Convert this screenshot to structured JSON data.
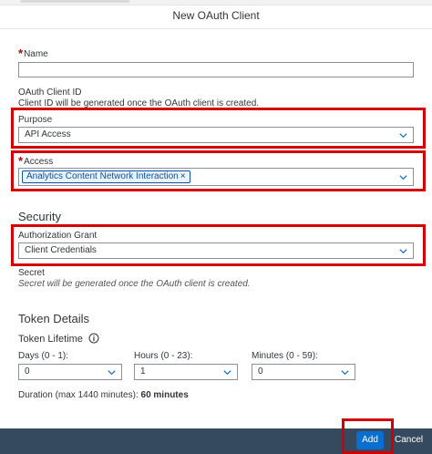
{
  "dialog": {
    "title": "New OAuth Client"
  },
  "form": {
    "name_label": "Name",
    "name_value": "",
    "client_id_label": "OAuth Client ID",
    "client_id_note": "Client ID will be generated once the OAuth client is created.",
    "purpose_label": "Purpose",
    "purpose_value": "API Access",
    "access_label": "Access",
    "access_token": "Analytics Content Network Interaction",
    "access_token_remove": "×",
    "security_heading": "Security",
    "auth_grant_label": "Authorization Grant",
    "auth_grant_value": "Client Credentials",
    "secret_label": "Secret",
    "secret_note": "Secret will be generated once the OAuth client is created.",
    "token_details_heading": "Token Details",
    "token_lifetime_label": "Token Lifetime",
    "days_label": "Days (0 - 1):",
    "days_value": "0",
    "hours_label": "Hours (0 - 23):",
    "hours_value": "1",
    "minutes_label": "Minutes (0 - 59):",
    "minutes_value": "0",
    "duration_label": "Duration (max 1440 minutes):",
    "duration_value": "60 minutes"
  },
  "footer": {
    "add_label": "Add",
    "cancel_label": "Cancel"
  },
  "icons": {
    "chevron": "chevron-down-icon",
    "info": "info-icon",
    "required": "*"
  },
  "colors": {
    "highlight": "#d40000",
    "footer_bg": "#354a5f",
    "primary_button": "#0a6ed1",
    "token_border": "#0854a0"
  }
}
